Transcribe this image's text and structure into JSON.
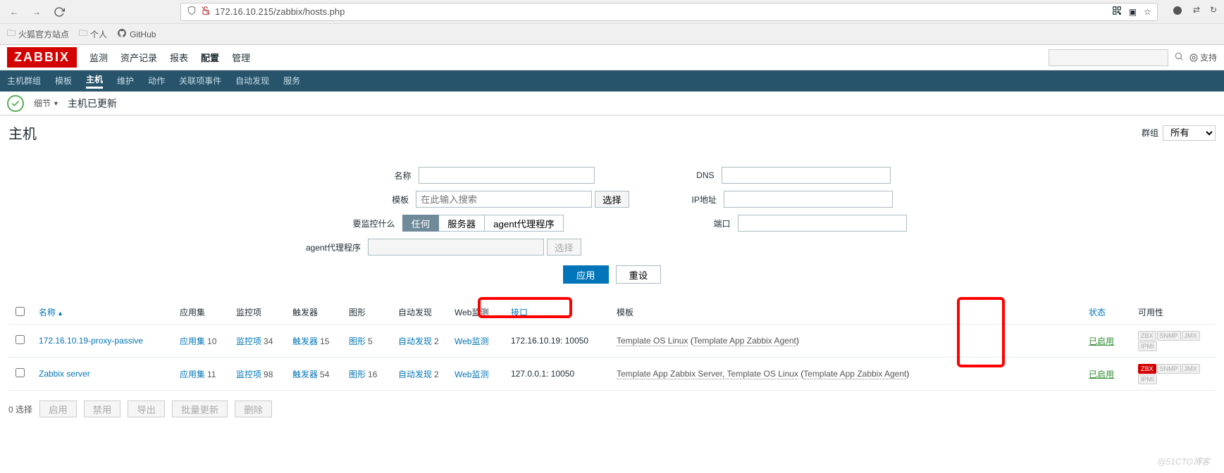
{
  "browser": {
    "url": "172.16.10.215/zabbix/hosts.php",
    "bookmarks": [
      {
        "label": "火狐官方站点",
        "icon": "folder"
      },
      {
        "label": "个人",
        "icon": "folder"
      },
      {
        "label": "GitHub",
        "icon": "github"
      }
    ]
  },
  "top_nav": {
    "logo": "ZABBIX",
    "items": [
      "监测",
      "资产记录",
      "报表",
      "配置",
      "管理"
    ],
    "active": "配置",
    "support": "支持"
  },
  "sub_nav": {
    "items": [
      "主机群组",
      "模板",
      "主机",
      "维护",
      "动作",
      "关联项事件",
      "自动发现",
      "服务"
    ],
    "active": "主机"
  },
  "notice": {
    "detail_label": "细节",
    "message": "主机已更新"
  },
  "page": {
    "title": "主机",
    "group_label": "群组",
    "group_value": "所有"
  },
  "filters": {
    "name_label": "名称",
    "template_label": "模板",
    "template_placeholder": "在此输入搜索",
    "select_btn": "选择",
    "monitor_label": "要监控什么",
    "monitor_opts": [
      "任何",
      "服务器",
      "agent代理程序"
    ],
    "monitor_active": "任何",
    "proxy_label": "agent代理程序",
    "dns_label": "DNS",
    "ip_label": "IP地址",
    "port_label": "端口",
    "apply_btn": "应用",
    "reset_btn": "重设"
  },
  "table": {
    "headers": {
      "name": "名称",
      "apps": "应用集",
      "items": "监控项",
      "triggers": "触发器",
      "graphs": "图形",
      "discovery": "自动发现",
      "web": "Web监测",
      "interface": "接口",
      "templates": "模板",
      "status": "状态",
      "availability": "可用性"
    },
    "rows": [
      {
        "name": "172.16.10.19-proxy-passive",
        "apps": "10",
        "items": "34",
        "triggers": "15",
        "graphs": "5",
        "discovery": "2",
        "web": "",
        "interface": "172.16.10.19: 10050",
        "templates_text": "Template OS Linux",
        "templates_sub": "Template App Zabbix Agent",
        "status": "已启用",
        "zbx_red": false
      },
      {
        "name": "Zabbix server",
        "apps": "11",
        "items": "98",
        "triggers": "54",
        "graphs": "16",
        "discovery": "2",
        "web": "",
        "interface": "127.0.0.1: 10050",
        "templates_text": "Template App Zabbix Server, Template OS Linux",
        "templates_sub": "Template App Zabbix Agent",
        "status": "已启用",
        "zbx_red": true
      }
    ],
    "col_labels": {
      "apps": "应用集",
      "items": "监控项",
      "triggers": "触发器",
      "graphs": "图形",
      "discovery": "自动发现",
      "web": "Web监测"
    },
    "avail": [
      "ZBX",
      "SNMP",
      "JMX",
      "IPMI"
    ]
  },
  "footer": {
    "selected": "0 选择",
    "buttons": [
      "启用",
      "禁用",
      "导出",
      "批量更新",
      "删除"
    ]
  },
  "watermark": "@51CTO博客"
}
